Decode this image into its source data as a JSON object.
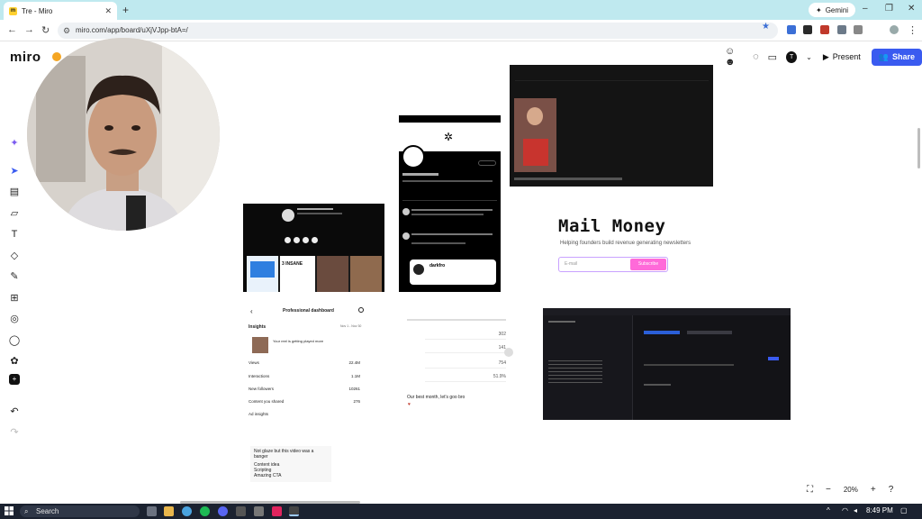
{
  "browser": {
    "tab_title": "Tre - Miro",
    "tab_favicon": "miro-favicon",
    "new_tab": "+",
    "gemini_label": "Gemini",
    "url": "miro.com/app/board/uXjVJpp-btA=/",
    "window_controls": [
      "–",
      "❐",
      "✕"
    ]
  },
  "miro": {
    "logo": "miro",
    "present_label": "Present",
    "share_label": "Share",
    "avatar_initial": "T",
    "zoom_level": "20%",
    "left_tools": [
      "sparkle-icon",
      "select-icon",
      "template-icon",
      "sticky-icon",
      "text-icon",
      "shapes-icon",
      "pen-icon",
      "frame-icon",
      "comment-icon",
      "chat-icon",
      "apps-icon",
      "upload-icon",
      "undo-icon",
      "redo-icon"
    ]
  },
  "board": {
    "mail_money": {
      "title": "Mail Money",
      "subtitle": "Helping founders build revenue generating newsletters",
      "email_placeholder": "E-mail",
      "subscribe_label": "Subscribe"
    },
    "tweet_post": {
      "author": "darkfro",
      "badge": "3 INSANE"
    },
    "dashboard": {
      "back": "‹",
      "title": "Professional dashboard",
      "insights_label": "Insights",
      "date_range": "Nov 1 - Nov 30",
      "reel_text": "Your reel is getting played more",
      "rows": [
        {
          "label": "Views",
          "value": "22.4M"
        },
        {
          "label": "Interactions",
          "value": "1.1M"
        },
        {
          "label": "New followers",
          "value": "10261"
        },
        {
          "label": "Content you shared",
          "value": "276"
        },
        {
          "label": "Ad insights",
          "value": ""
        }
      ]
    },
    "note": {
      "lines": [
        "Not glaze but this video was a banger",
        "Content idea",
        "Scripting",
        "Amazing CTA"
      ]
    },
    "stats_card": {
      "caption": "Our best month, let's goo bro",
      "values": [
        "302",
        "141",
        "754",
        "51.9%"
      ]
    }
  },
  "taskbar": {
    "search_placeholder": "Search",
    "time": "8:49 PM"
  },
  "colors": {
    "tab_strip": "#bfe9ef",
    "share_button": "#3a5bf0",
    "subscribe_button": "#ff6ad9",
    "taskbar": "#1b2230"
  }
}
